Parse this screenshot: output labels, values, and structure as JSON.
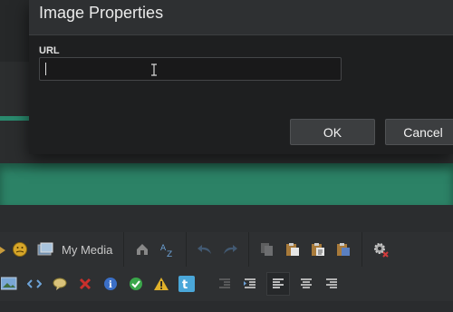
{
  "dialog": {
    "title": "Image Properties",
    "url_label": "URL",
    "url_value": "",
    "ok_label": "OK",
    "cancel_label": "Cancel"
  },
  "toolbar": {
    "my_media_label": "My Media"
  },
  "colors": {
    "teal": "#2c8266",
    "dialog_bg": "#1e1f20",
    "header_bg": "#2e3032"
  },
  "icons": {
    "row1": [
      "pencil-icon",
      "smiley-icon",
      "media-icon",
      "anchor-icon",
      "spellcheck-icon",
      "undo-icon",
      "redo-icon",
      "copy-icon",
      "paste-icon",
      "paste-text-icon",
      "paste-word-icon",
      "settings-icon"
    ],
    "row2": [
      "image-icon",
      "code-icon",
      "comment-icon",
      "error-icon",
      "info-icon",
      "success-icon",
      "warning-icon",
      "twitter-icon",
      "outdent-icon",
      "indent-icon",
      "align-left-icon",
      "align-center-icon",
      "align-right-icon"
    ]
  }
}
